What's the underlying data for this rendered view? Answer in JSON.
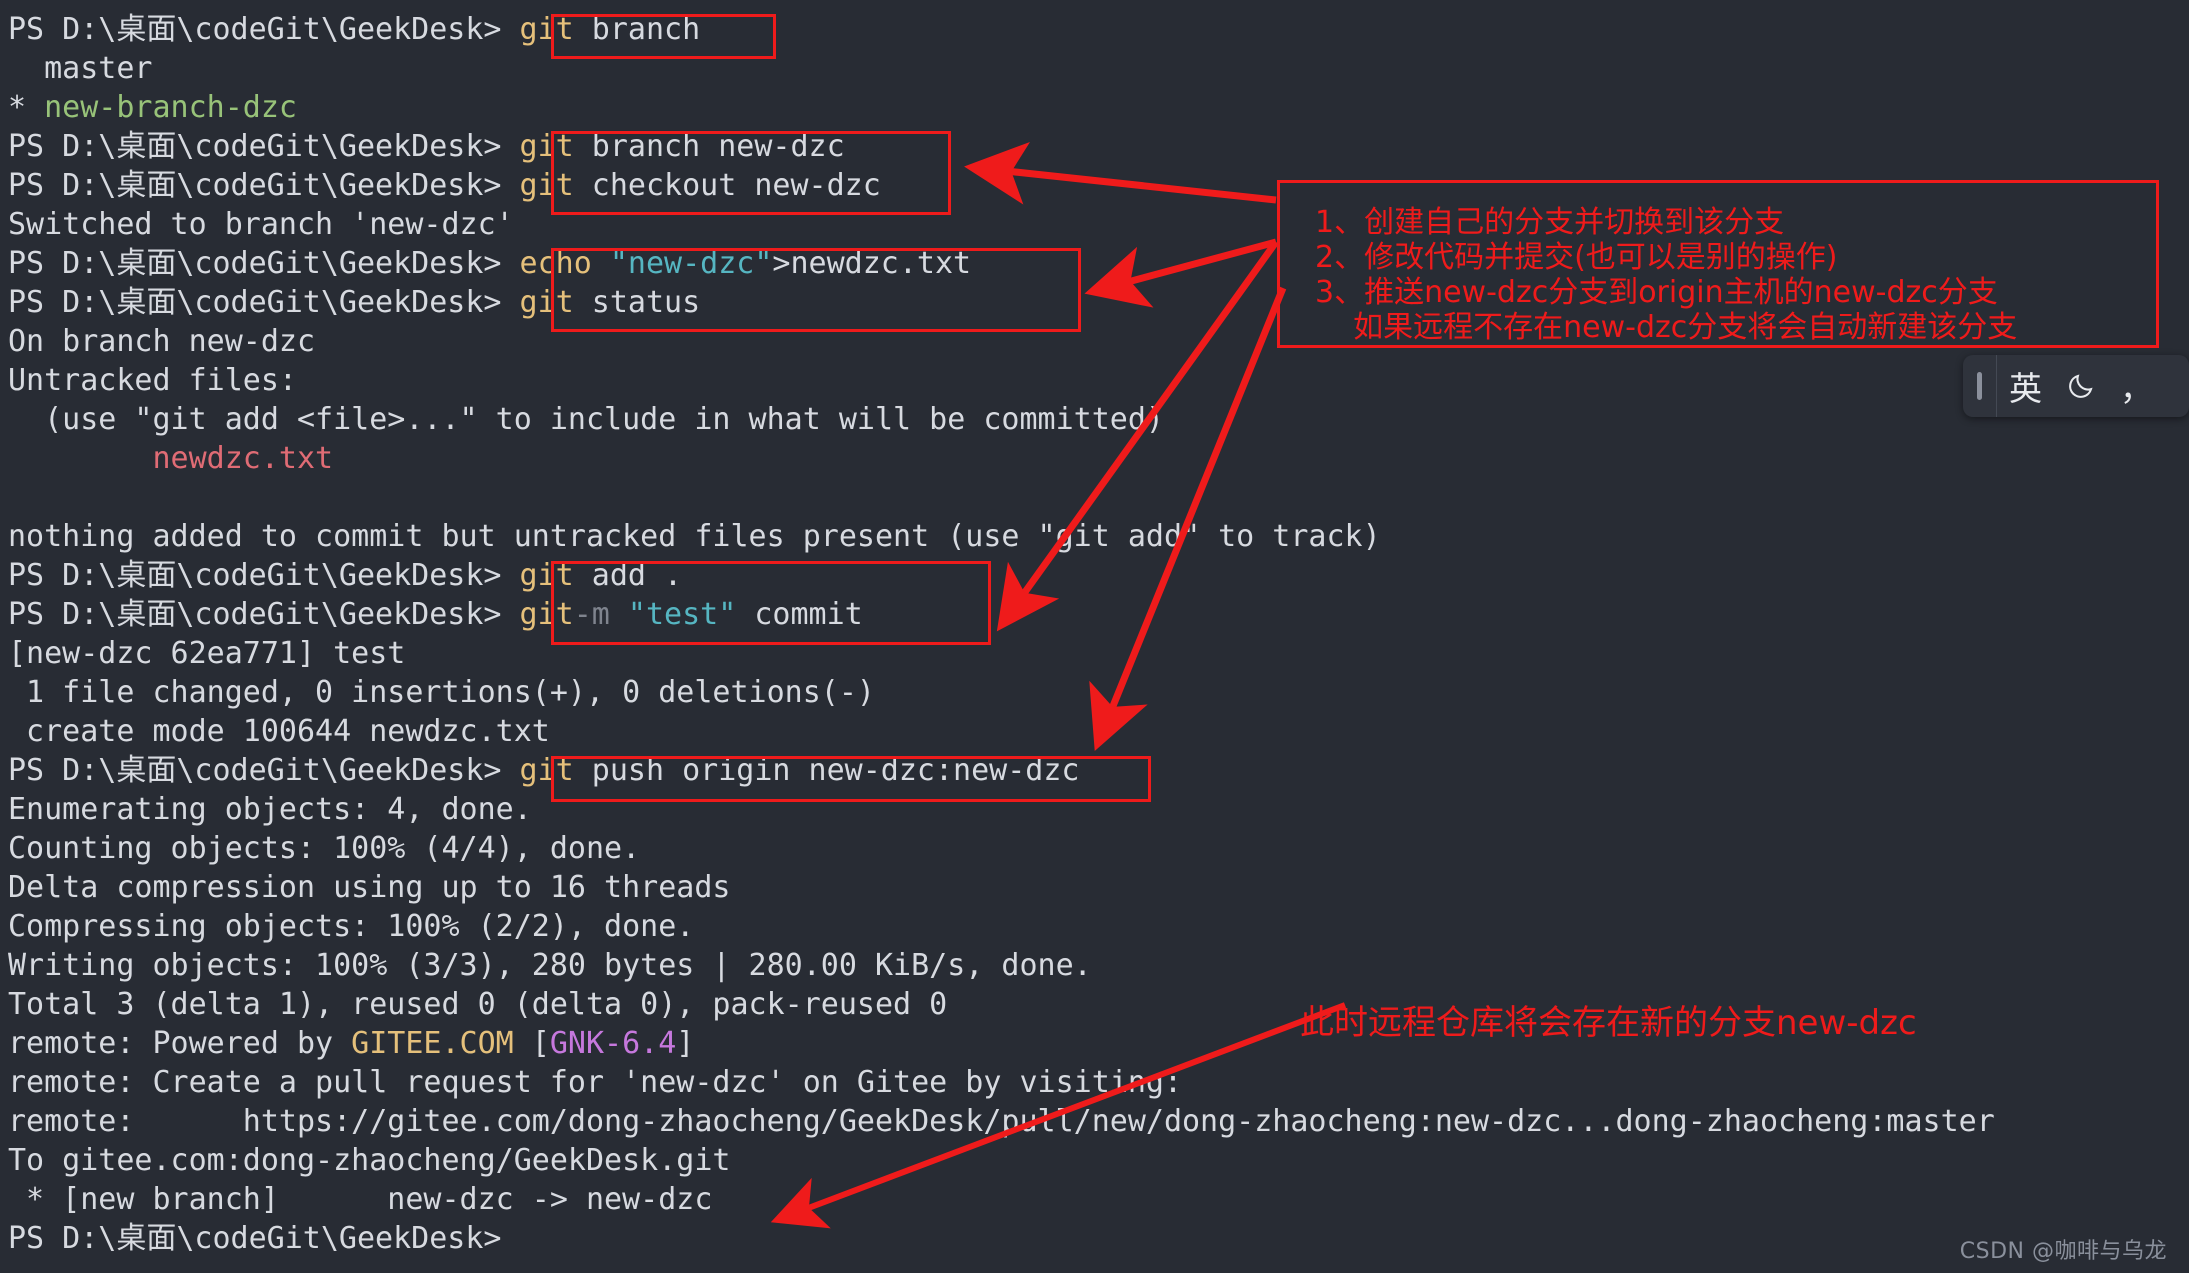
{
  "terminal": {
    "prompt": "PS D:\\桌面\\codeGit\\GeekDesk>",
    "lines": [
      {
        "id": "l1",
        "prompt": "PS D:\\桌面\\codeGit\\GeekDesk>",
        "cmd": "git",
        "args": " branch"
      },
      {
        "id": "l2",
        "text": "  master"
      },
      {
        "id": "l3",
        "pre": "* ",
        "green": "new-branch-dzc"
      },
      {
        "id": "l4",
        "prompt": "PS D:\\桌面\\codeGit\\GeekDesk>",
        "cmd": "git",
        "args": " branch new-dzc"
      },
      {
        "id": "l5",
        "prompt": "PS D:\\桌面\\codeGit\\GeekDesk>",
        "cmd": "git",
        "args": " checkout new-dzc"
      },
      {
        "id": "l6",
        "text": "Switched to branch 'new-dzc'"
      },
      {
        "id": "l7",
        "prompt": "PS D:\\桌面\\codeGit\\GeekDesk>",
        "cmd": "echo",
        "str": " \"new-dzc\"",
        "args": ">newdzc.txt"
      },
      {
        "id": "l8",
        "prompt": "PS D:\\桌面\\codeGit\\GeekDesk>",
        "cmd": "git",
        "args": " status"
      },
      {
        "id": "l9",
        "text": "On branch new-dzc"
      },
      {
        "id": "l10",
        "text": "Untracked files:"
      },
      {
        "id": "l11",
        "text": "  (use \"git add <file>...\" to include in what will be committed)"
      },
      {
        "id": "l12",
        "red": "        newdzc.txt"
      },
      {
        "id": "l13",
        "text": ""
      },
      {
        "id": "l14",
        "text": "nothing added to commit but untracked files present (use \"git add\" to track)"
      },
      {
        "id": "l15",
        "prompt": "PS D:\\桌面\\codeGit\\GeekDesk>",
        "cmd": "git",
        "args": " add ."
      },
      {
        "id": "l16",
        "prompt": "PS D:\\桌面\\codeGit\\GeekDesk>",
        "cmd": "git",
        "args": " commit ",
        "gray": "-m",
        "str": " \"test\""
      },
      {
        "id": "l17",
        "text": "[new-dzc 62ea771] test"
      },
      {
        "id": "l18",
        "text": " 1 file changed, 0 insertions(+), 0 deletions(-)"
      },
      {
        "id": "l19",
        "text": " create mode 100644 newdzc.txt"
      },
      {
        "id": "l20",
        "prompt": "PS D:\\桌面\\codeGit\\GeekDesk>",
        "cmd": "git",
        "args": " push origin new-dzc:new-dzc"
      },
      {
        "id": "l21",
        "text": "Enumerating objects: 4, done."
      },
      {
        "id": "l22",
        "text": "Counting objects: 100% (4/4), done."
      },
      {
        "id": "l23",
        "text": "Delta compression using up to 16 threads"
      },
      {
        "id": "l24",
        "text": "Compressing objects: 100% (2/2), done."
      },
      {
        "id": "l25",
        "text": "Writing objects: 100% (3/3), 280 bytes | 280.00 KiB/s, done."
      },
      {
        "id": "l26",
        "text": "Total 3 (delta 1), reused 0 (delta 0), pack-reused 0"
      },
      {
        "id": "l27",
        "pre": "remote: Powered by ",
        "gold": "GITEE.COM",
        "mid": " [",
        "magenta": "GNK-6.4",
        "post": "]"
      },
      {
        "id": "l28",
        "text": "remote: Create a pull request for 'new-dzc' on Gitee by visiting:"
      },
      {
        "id": "l29",
        "text": "remote:      https://gitee.com/dong-zhaocheng/GeekDesk/pull/new/dong-zhaocheng:new-dzc...dong-zhaocheng:master"
      },
      {
        "id": "l30",
        "text": "To gitee.com:dong-zhaocheng/GeekDesk.git"
      },
      {
        "id": "l31",
        "text": " * [new branch]      new-dzc -> new-dzc"
      },
      {
        "id": "l32",
        "prompt": "PS D:\\桌面\\codeGit\\GeekDesk>",
        "cmd": "",
        "args": ""
      }
    ]
  },
  "annotations": {
    "accent_color": "#ef1b1b",
    "panel_text": "1、创建自己的分支并切换到该分支\n2、修改代码并提交(也可以是别的操作)\n3、推送new-dzc分支到origin主机的new-dzc分支\n    如果远程不存在new-dzc分支将会自动新建该分支",
    "bottom_text": "此时远程仓库将会存在新的分支new-dzc"
  },
  "ime": {
    "mode_label": "英",
    "moon_icon": "moon-icon",
    "punct_label": "，"
  },
  "watermark": {
    "text": "CSDN @咖啡与乌龙"
  },
  "theme": {
    "background": "#282c34",
    "foreground": "#d7dae0",
    "command": "#e5c07b",
    "string": "#56b6c2",
    "branch_green": "#98c379",
    "untracked_red": "#e06c75",
    "magenta": "#c678dd",
    "annotation_red": "#ef1b1b"
  }
}
